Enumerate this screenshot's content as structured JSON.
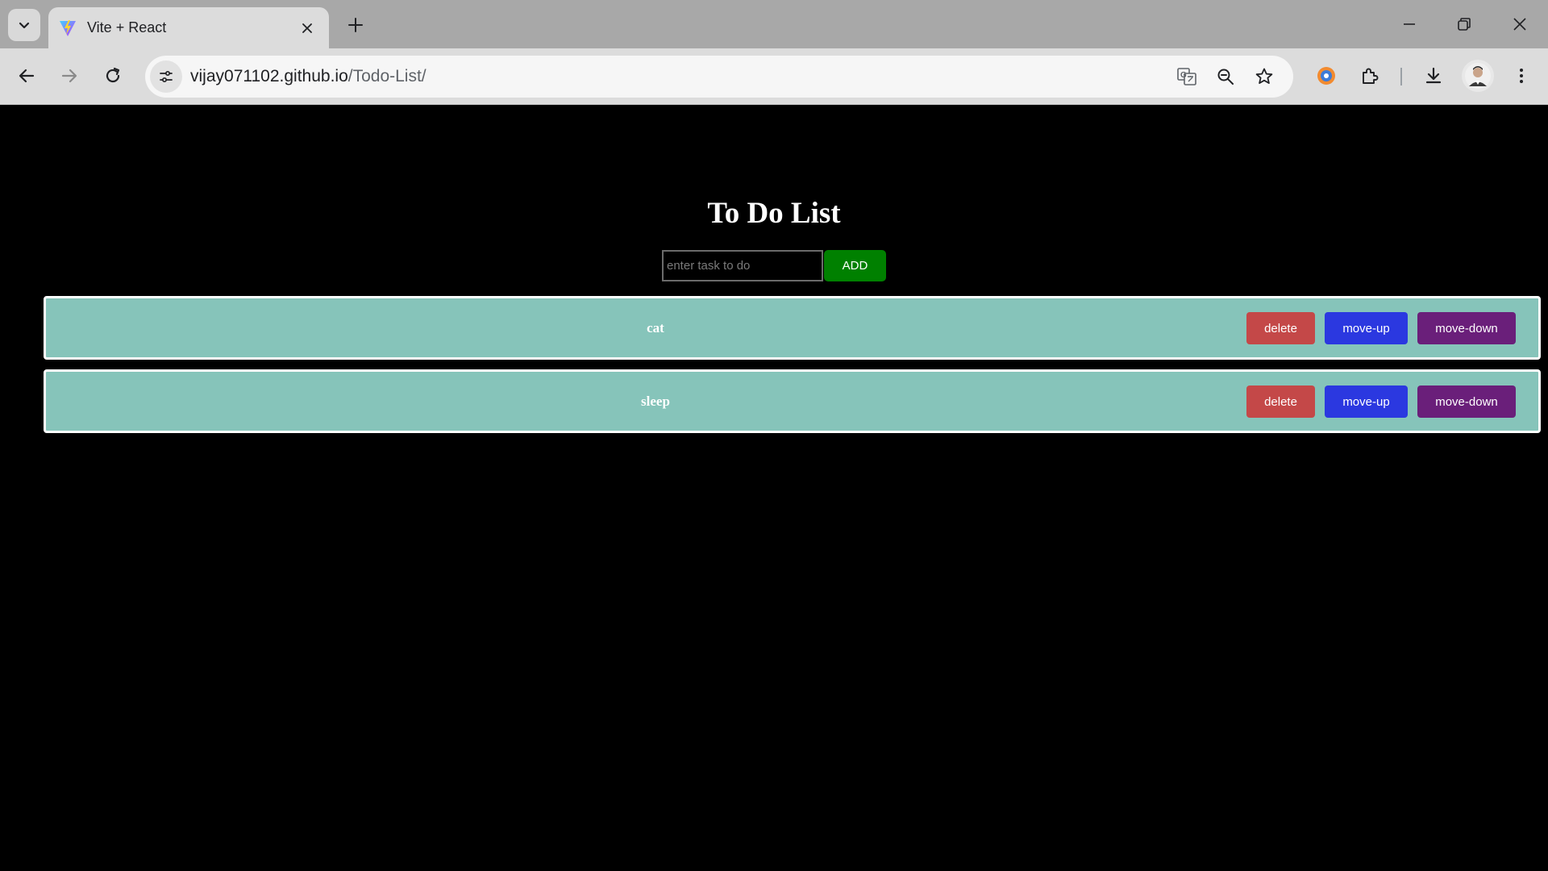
{
  "browser": {
    "tab_title": "Vite + React",
    "url_host": "vijay071102.github.io",
    "url_path": "/Todo-List/"
  },
  "page": {
    "title": "To Do List",
    "input_placeholder": "enter task to do",
    "input_value": "",
    "add_label": "ADD"
  },
  "todos": [
    {
      "text": "cat",
      "delete_label": "delete",
      "up_label": "move-up",
      "down_label": "move-down"
    },
    {
      "text": "sleep",
      "delete_label": "delete",
      "up_label": "move-up",
      "down_label": "move-down"
    }
  ],
  "colors": {
    "item_bg": "#86c4ba",
    "add": "#008000",
    "delete": "#c44848",
    "move_up": "#2b38e0",
    "move_down": "#6a1f7a"
  },
  "icons": [
    "tab-search-icon",
    "vite-favicon-icon",
    "close-icon",
    "plus-icon",
    "minimize-icon",
    "restore-icon",
    "back-icon",
    "forward-icon",
    "reload-icon",
    "site-info-icon",
    "translate-icon",
    "zoom-icon",
    "star-icon",
    "extension-puzzle-icon",
    "download-icon",
    "kebab-menu-icon"
  ]
}
